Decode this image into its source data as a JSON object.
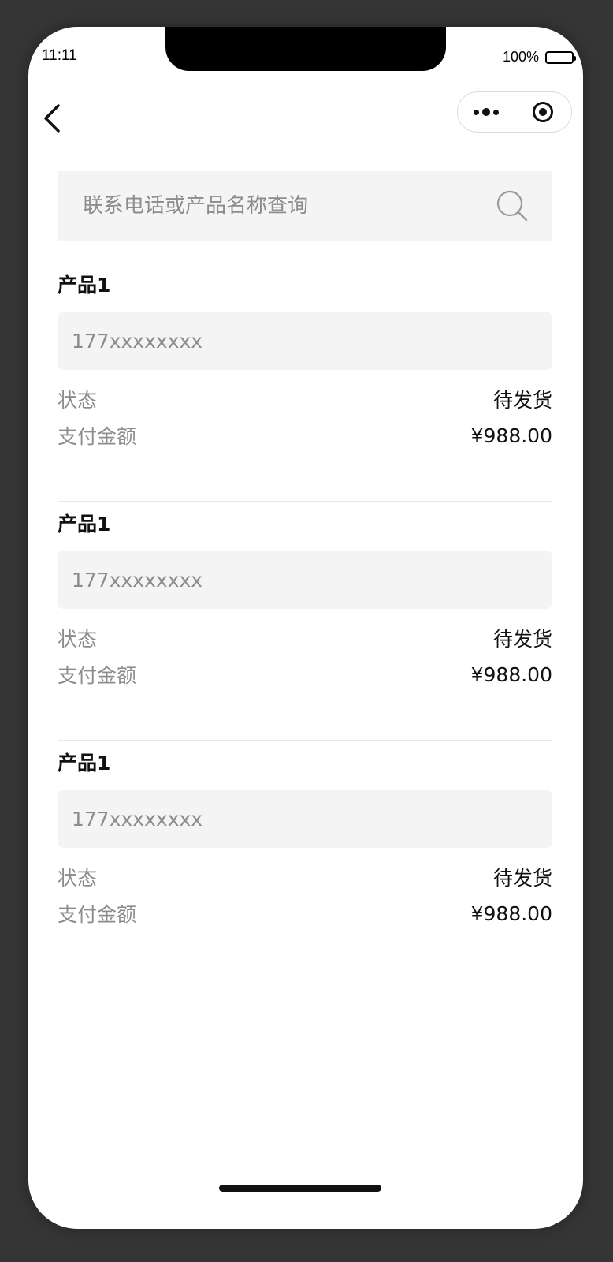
{
  "status_bar": {
    "time": "11:11",
    "battery_percent": "100%"
  },
  "nav": {
    "back_icon": "chevron-left-icon",
    "more_icon": "more-dots-icon",
    "close_icon": "target-circle-icon"
  },
  "search": {
    "placeholder": "联系电话或产品名称查询",
    "icon": "search-icon"
  },
  "orders": [
    {
      "product": "产品1",
      "phone": "177xxxxxxxx",
      "status_label": "状态",
      "status_value": "待发货",
      "amount_label": "支付金额",
      "amount_value": "¥988.00"
    },
    {
      "product": "产品1",
      "phone": "177xxxxxxxx",
      "status_label": "状态",
      "status_value": "待发货",
      "amount_label": "支付金额",
      "amount_value": "¥988.00"
    },
    {
      "product": "产品1",
      "phone": "177xxxxxxxx",
      "status_label": "状态",
      "status_value": "待发货",
      "amount_label": "支付金额",
      "amount_value": "¥988.00"
    }
  ],
  "colors": {
    "background": "#353535",
    "field_bg": "#f4f4f4",
    "muted_text": "#8c8c8c",
    "primary_text": "#111111"
  }
}
